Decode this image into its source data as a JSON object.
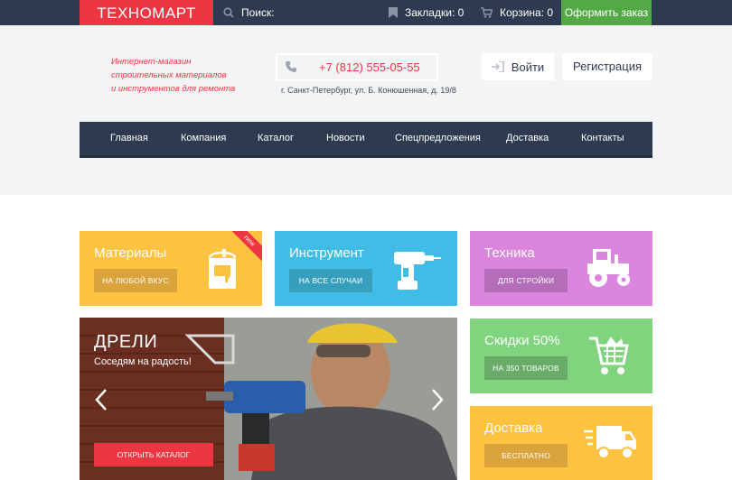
{
  "colors": {
    "dark": "#2d3a4f",
    "red": "#ee3643",
    "green": "#54a946"
  },
  "topbar": {
    "logo": "ТЕХНОМАРТ",
    "search_label": "Поиск:",
    "search_icon": "search-icon",
    "bookmarks": "Закладки: 0",
    "cart": "Корзина: 0",
    "order": "Оформить заказ"
  },
  "header": {
    "tagline": [
      "Интернет-магазин",
      "строительных материалов",
      "и инструментов для ремонта"
    ],
    "phone": "+7 (812) 555-05-55",
    "address": "г. Санкт-Петербург, ул. Б. Конюшенная, д. 19/8",
    "login": "Войти",
    "register": "Регистрация"
  },
  "nav": {
    "items": [
      {
        "label": "Главная"
      },
      {
        "label": "Компания"
      },
      {
        "label": "Каталог"
      },
      {
        "label": "Новости"
      },
      {
        "label": "Спецпредложения"
      },
      {
        "label": "Доставка"
      },
      {
        "label": "Контакты"
      }
    ]
  },
  "tiles": {
    "materials": {
      "title": "Материалы",
      "button": "НА ЛЮБОЙ ВКУС",
      "badge": "new",
      "color": "#fdc240",
      "icon": "paint-bucket-icon"
    },
    "tools": {
      "title": "Инструмент",
      "button": "НА ВСЕ СЛУЧАИ",
      "color": "#3fbde6",
      "icon": "drill-icon"
    },
    "tech": {
      "title": "Техника",
      "button": "ДЛЯ СТРОЙКИ",
      "color": "#db85dd",
      "icon": "tractor-icon"
    },
    "sale": {
      "title": "Скидки 50%",
      "button": "НА 350 ТОВАРОВ",
      "color": "#7fd47d",
      "icon": "cart-icon"
    },
    "delivery": {
      "title": "Доставка",
      "button": "БЕСПЛАТНО",
      "color": "#fdc240",
      "icon": "truck-icon"
    }
  },
  "slider": {
    "title": "ДРЕЛИ",
    "subtitle": "Соседям на радость!",
    "button": "ОТКРЫТЬ КАТАЛОГ"
  }
}
